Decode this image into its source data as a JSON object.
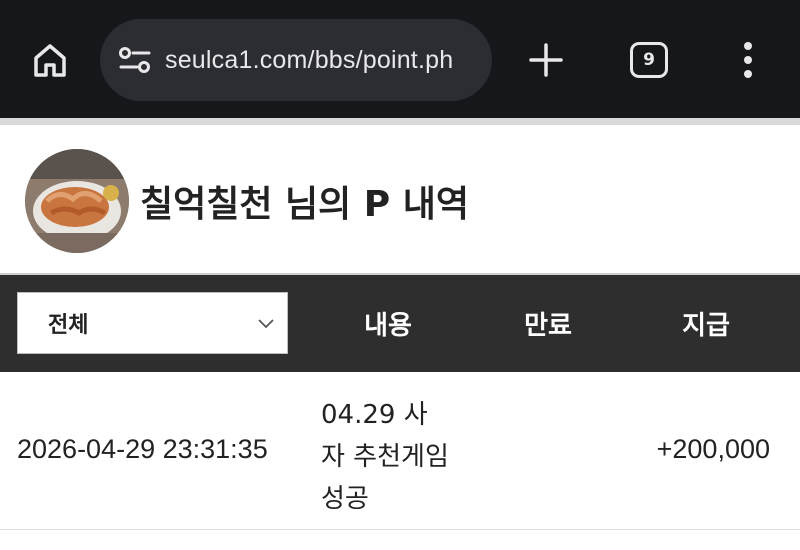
{
  "browser": {
    "url": "seulca1.com/bbs/point.ph",
    "tab_count": "9",
    "icons": {
      "home": "home-icon",
      "site_settings": "tune-icon",
      "new_tab": "plus-icon",
      "menu": "more-vert-icon"
    },
    "colors": {
      "toolbar_bg": "#16171b",
      "urlbar_bg": "#2b2d33",
      "text": "#e8e8ea"
    }
  },
  "profile": {
    "title": "칠억칠천 님의 P 내역"
  },
  "table": {
    "filter": {
      "selected": "전체"
    },
    "headers": {
      "content": "내용",
      "expire": "만료",
      "paid": "지급"
    },
    "rows": [
      {
        "date": "2026-04-29 23:31:35",
        "content": "04.29 사자 추천게임 성공",
        "expire": "",
        "paid": "+200,000"
      }
    ],
    "colors": {
      "header_bg": "#2e2e2e",
      "header_text": "#ffffff"
    }
  }
}
